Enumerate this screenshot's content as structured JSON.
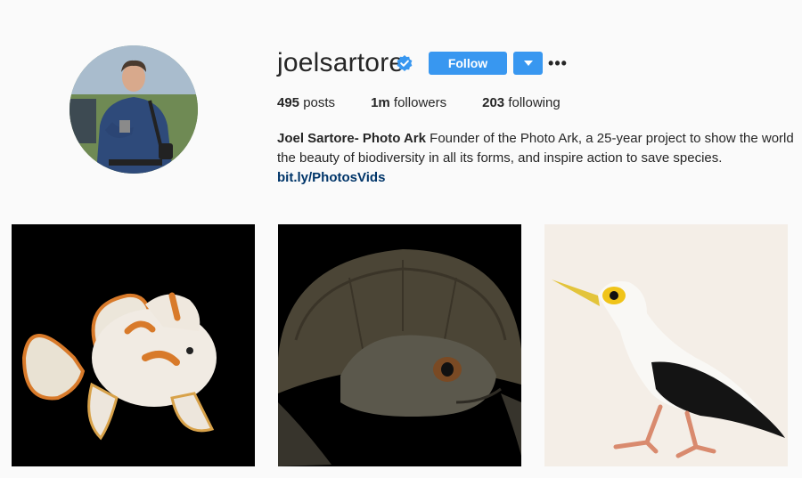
{
  "profile": {
    "username": "joelsartore",
    "verified": true,
    "follow_label": "Follow",
    "more_label": "•••",
    "accent_color": "#3897f0"
  },
  "stats": {
    "posts_count": "495",
    "posts_label": "posts",
    "followers_count": "1m",
    "followers_label": "followers",
    "following_count": "203",
    "following_label": "following"
  },
  "bio": {
    "name": "Joel Sartore- Photo Ark",
    "text": " Founder of the Photo Ark, a 25-year project to show the world the beauty of biodiversity in all its forms, and inspire action to save species. ",
    "link": "bit.ly/PhotosVids"
  },
  "posts": [
    {
      "subject": "frogfish-photo",
      "background": "#000000"
    },
    {
      "subject": "turtle-photo",
      "background": "#000000"
    },
    {
      "subject": "bird-photo",
      "background": "#f3ede6"
    }
  ]
}
